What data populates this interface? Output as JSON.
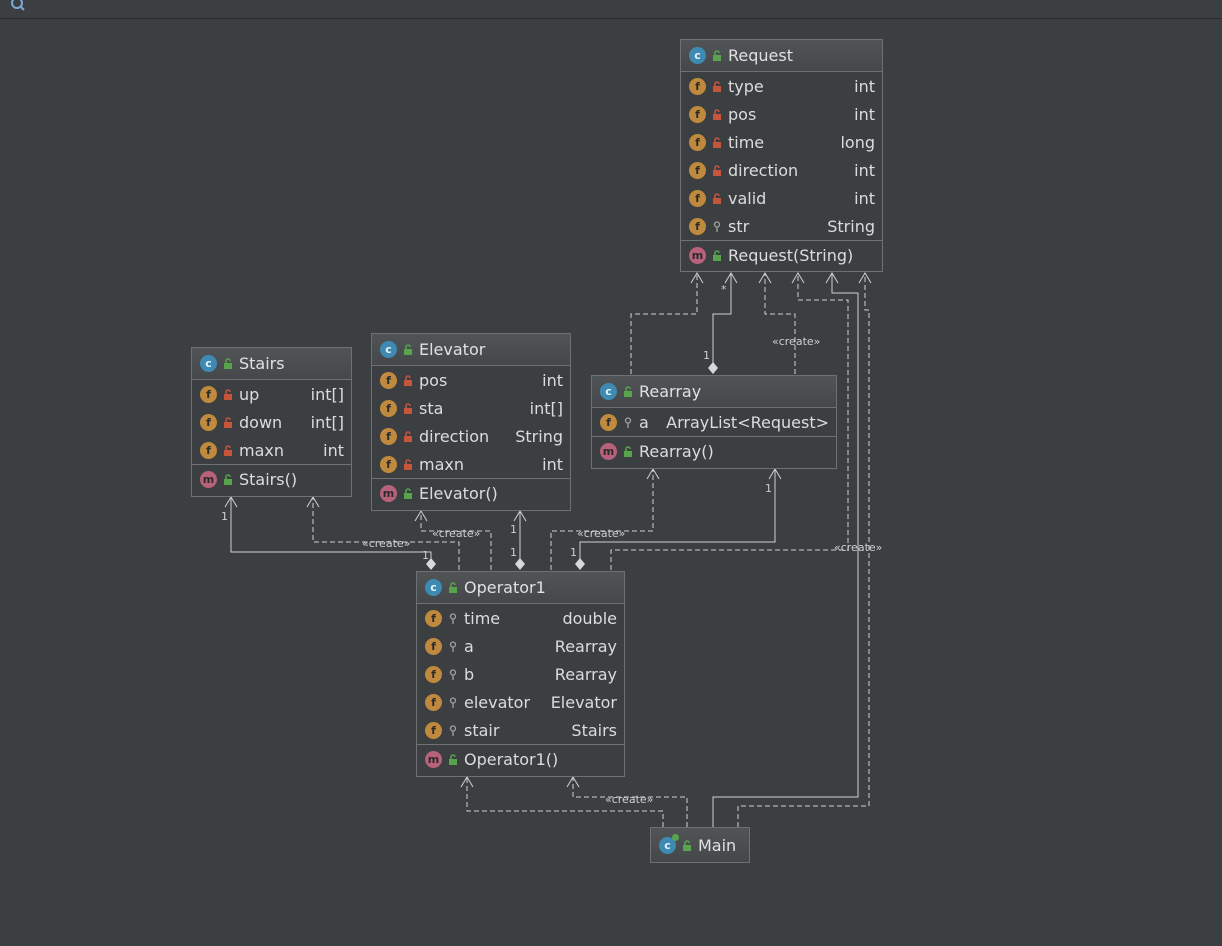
{
  "toolbar": {
    "icon": "search-icon"
  },
  "labels": {
    "create": "«create»",
    "mult_one": "1",
    "mult_many": "*"
  },
  "classes": {
    "request": {
      "name": "Request",
      "fields": [
        {
          "name": "type",
          "type": "int",
          "visibility": "private"
        },
        {
          "name": "pos",
          "type": "int",
          "visibility": "private"
        },
        {
          "name": "time",
          "type": "long",
          "visibility": "private"
        },
        {
          "name": "direction",
          "type": "int",
          "visibility": "private"
        },
        {
          "name": "valid",
          "type": "int",
          "visibility": "private"
        },
        {
          "name": "str",
          "type": "String",
          "visibility": "package"
        }
      ],
      "methods": [
        {
          "name": "Request(String)",
          "visibility": "public"
        }
      ]
    },
    "stairs": {
      "name": "Stairs",
      "fields": [
        {
          "name": "up",
          "type": "int[]",
          "visibility": "private"
        },
        {
          "name": "down",
          "type": "int[]",
          "visibility": "private"
        },
        {
          "name": "maxn",
          "type": "int",
          "visibility": "private"
        }
      ],
      "methods": [
        {
          "name": "Stairs()",
          "visibility": "public"
        }
      ]
    },
    "elevator": {
      "name": "Elevator",
      "fields": [
        {
          "name": "pos",
          "type": "int",
          "visibility": "private"
        },
        {
          "name": "sta",
          "type": "int[]",
          "visibility": "private"
        },
        {
          "name": "direction",
          "type": "String",
          "visibility": "private"
        },
        {
          "name": "maxn",
          "type": "int",
          "visibility": "private"
        }
      ],
      "methods": [
        {
          "name": "Elevator()",
          "visibility": "public"
        }
      ]
    },
    "rearray": {
      "name": "Rearray",
      "fields": [
        {
          "name": "a",
          "type": "ArrayList<Request>",
          "visibility": "package"
        }
      ],
      "methods": [
        {
          "name": "Rearray()",
          "visibility": "public"
        }
      ]
    },
    "operator1": {
      "name": "Operator1",
      "fields": [
        {
          "name": "time",
          "type": "double",
          "visibility": "package"
        },
        {
          "name": "a",
          "type": "Rearray",
          "visibility": "package"
        },
        {
          "name": "b",
          "type": "Rearray",
          "visibility": "package"
        },
        {
          "name": "elevator",
          "type": "Elevator",
          "visibility": "package"
        },
        {
          "name": "stair",
          "type": "Stairs",
          "visibility": "package"
        }
      ],
      "methods": [
        {
          "name": "Operator1()",
          "visibility": "public"
        }
      ]
    },
    "main": {
      "name": "Main",
      "fields": [],
      "methods": []
    }
  },
  "colors": {
    "background": "#3c3f41",
    "border": "#6e7173",
    "class_badge": "#3e8ab3",
    "field_badge": "#c08a3e",
    "method_badge": "#b7617b",
    "private_lock": "#c5553b",
    "public_lock": "#58a34c",
    "edge": "#d0d0d0"
  }
}
